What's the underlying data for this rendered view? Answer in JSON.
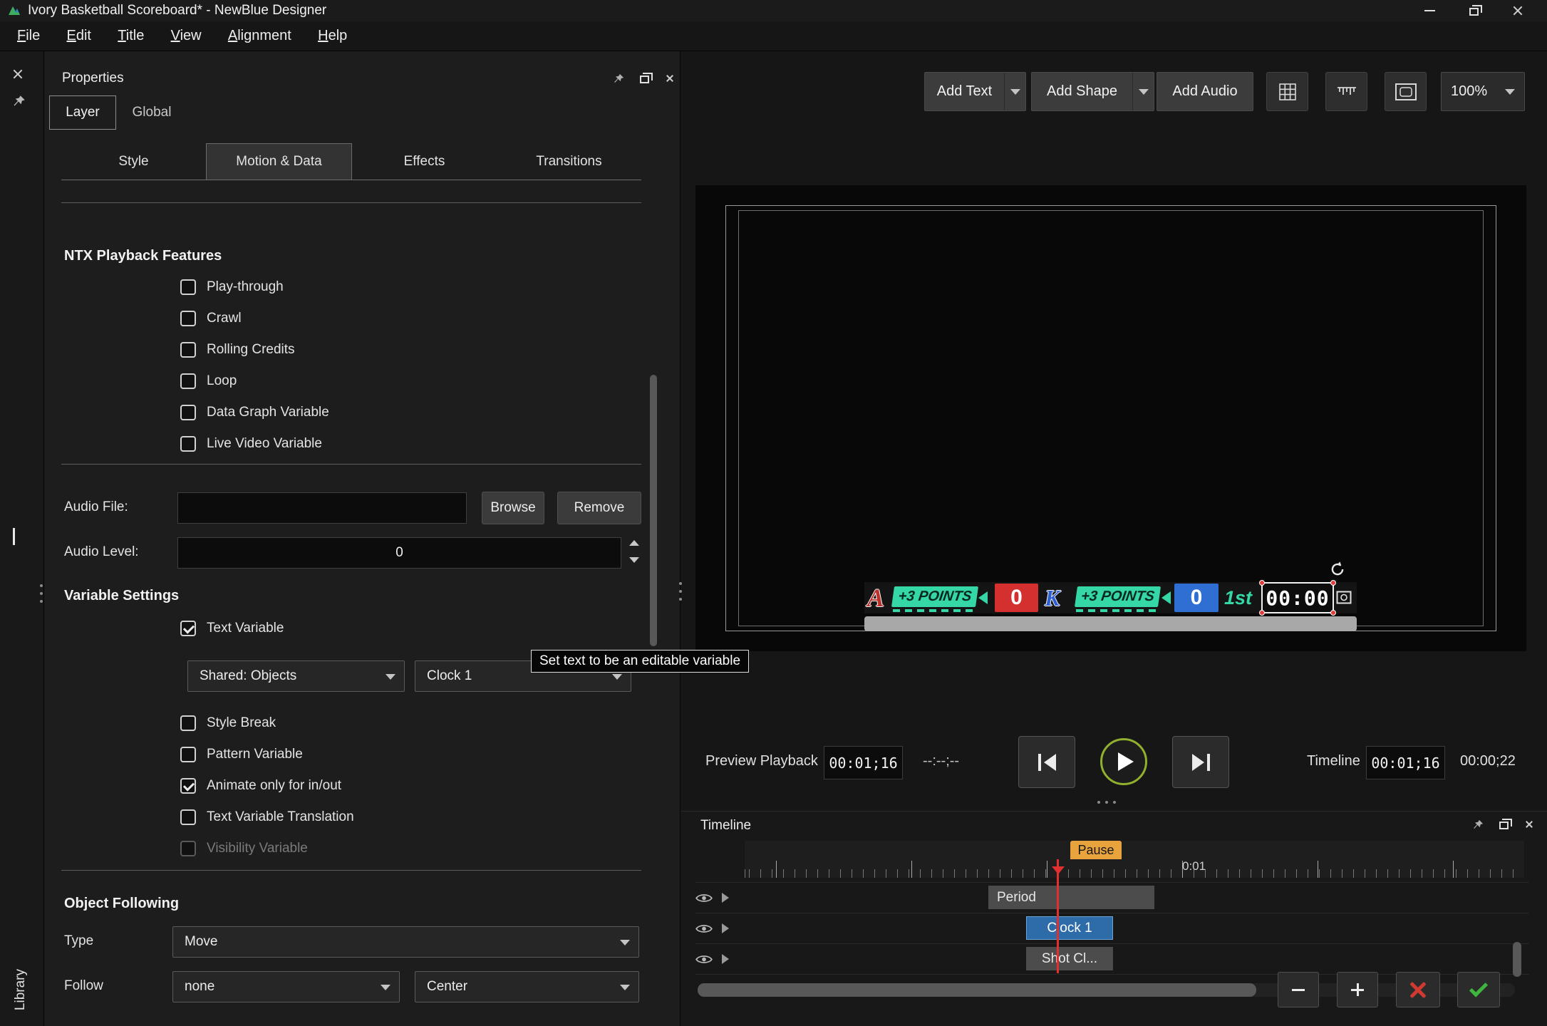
{
  "window": {
    "title": "Ivory Basketball Scoreboard* - NewBlue Designer"
  },
  "menu": {
    "items": [
      "File",
      "Edit",
      "Title",
      "View",
      "Alignment",
      "Help"
    ]
  },
  "left_rail": {
    "library_label": "Library"
  },
  "properties_panel": {
    "title": "Properties",
    "tabs": [
      {
        "label": "Layer",
        "active": true
      },
      {
        "label": "Global",
        "active": false
      }
    ],
    "subtabs": [
      {
        "label": "Style",
        "active": false
      },
      {
        "label": "Motion & Data",
        "active": true
      },
      {
        "label": "Effects",
        "active": false
      },
      {
        "label": "Transitions",
        "active": false
      }
    ],
    "ntx_section": {
      "heading": "NTX Playback Features",
      "options": [
        {
          "label": "Play-through",
          "checked": false
        },
        {
          "label": "Crawl",
          "checked": false
        },
        {
          "label": "Rolling Credits",
          "checked": false
        },
        {
          "label": "Loop",
          "checked": false
        },
        {
          "label": "Data Graph Variable",
          "checked": false
        },
        {
          "label": "Live Video Variable",
          "checked": false
        }
      ]
    },
    "audio_section": {
      "file_label": "Audio File:",
      "file_value": "",
      "browse_button": "Browse",
      "remove_button": "Remove",
      "level_label": "Audio Level:",
      "level_value": "0"
    },
    "variable_section": {
      "heading": "Variable Settings",
      "text_variable": {
        "label": "Text Variable",
        "checked": true
      },
      "shared_dropdown": {
        "value": "Shared: Objects"
      },
      "variable_dropdown": {
        "value": "Clock 1"
      },
      "options": [
        {
          "label": "Style Break",
          "checked": false
        },
        {
          "label": "Pattern Variable",
          "checked": false
        },
        {
          "label": "Animate only for in/out",
          "checked": true
        },
        {
          "label": "Text Variable Translation",
          "checked": false
        },
        {
          "label": "Visibility Variable",
          "checked": false,
          "disabled": true
        }
      ]
    },
    "object_following_section": {
      "heading": "Object Following",
      "type_label": "Type",
      "type_dropdown": {
        "value": "Move"
      },
      "follow_label": "Follow",
      "follow_dropdown": {
        "value": "none"
      },
      "anchor_dropdown": {
        "value": "Center"
      }
    }
  },
  "tooltip": {
    "text": "Set text to be an editable variable"
  },
  "design_toolbar": {
    "add_text_button": "Add Text",
    "add_shape_button": "Add Shape",
    "add_audio_button": "Add Audio",
    "zoom_dropdown": {
      "value": "100%"
    }
  },
  "preview": {
    "scoreboard": {
      "home_logo_letter": "A",
      "home_bonus_badge": "+3 POINTS",
      "home_score": "0",
      "away_logo_letter": "K",
      "away_bonus_badge": "+3 POINTS",
      "away_score": "0",
      "period": "1st",
      "game_clock": "00:00"
    }
  },
  "playback_bar": {
    "preview_playback_label": "Preview Playback",
    "preview_time": "00:01;16",
    "secondary_time": "--:--;--",
    "timeline_label": "Timeline",
    "timeline_time": "00:01;16",
    "total_time": "00:00;22"
  },
  "timeline_panel": {
    "title": "Timeline",
    "pause_marker_label": "Pause",
    "ruler_tick_label": "0:01",
    "tracks": [
      {
        "label": "Period",
        "selected": false
      },
      {
        "label": "Clock 1",
        "selected": true
      },
      {
        "label": "Shot Cl...",
        "selected": false
      }
    ]
  },
  "colors": {
    "accent_green": "#35d7a7",
    "score_red": "#d43030",
    "score_blue": "#2f6fd3",
    "pause_orange": "#e8a33d",
    "selected_track_blue": "#2d6ca8",
    "play_ring_green": "#90b02e",
    "cancel_red": "#d13a30",
    "confirm_green": "#3fb53f"
  }
}
